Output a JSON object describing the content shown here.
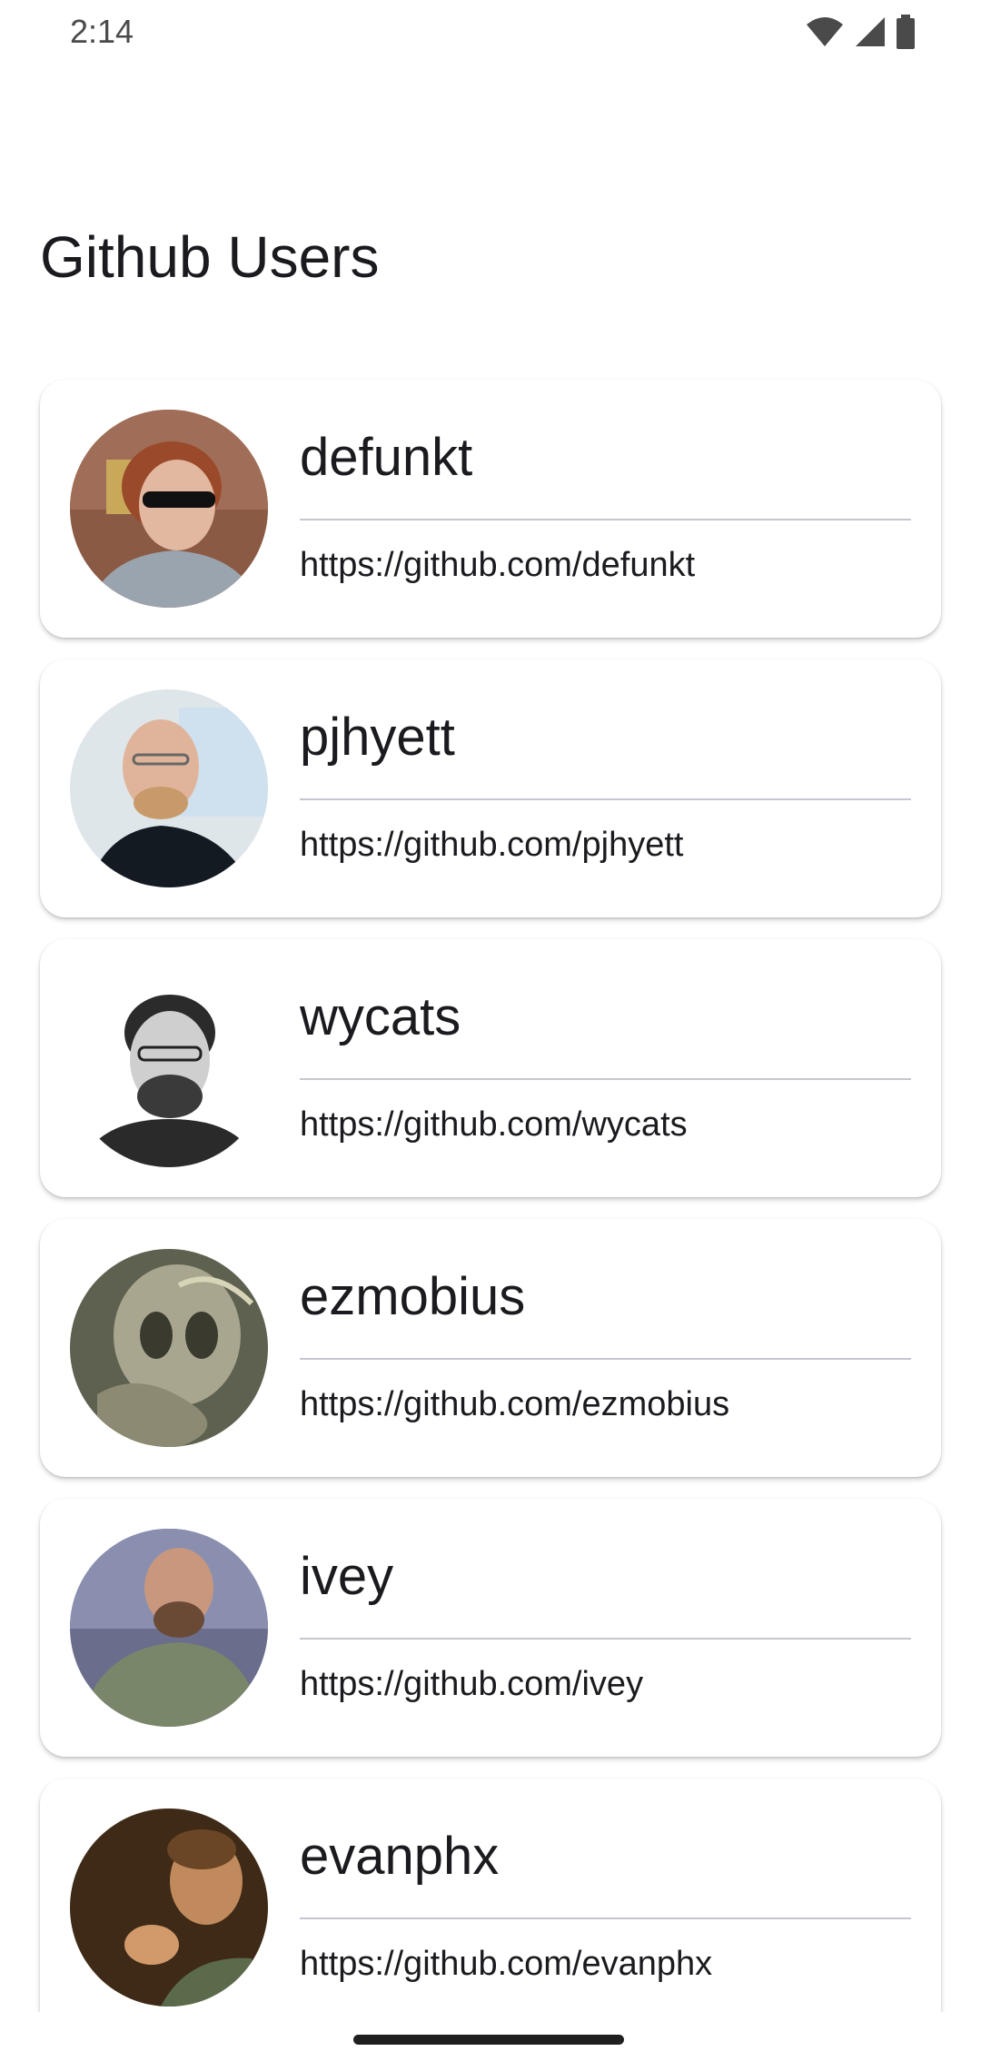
{
  "status_bar": {
    "time": "2:14",
    "icons": [
      "wifi-icon",
      "cell-signal-icon",
      "battery-icon"
    ]
  },
  "header": {
    "title": "Github Users"
  },
  "users": [
    {
      "login": "defunkt",
      "url": "https://github.com/defunkt"
    },
    {
      "login": "pjhyett",
      "url": "https://github.com/pjhyett"
    },
    {
      "login": "wycats",
      "url": "https://github.com/wycats"
    },
    {
      "login": "ezmobius",
      "url": "https://github.com/ezmobius"
    },
    {
      "login": "ivey",
      "url": "https://github.com/ivey"
    },
    {
      "login": "evanphx",
      "url": "https://github.com/evanphx"
    }
  ],
  "colors": {
    "background": "#ffffff",
    "text": "#1b1b1f",
    "divider": "#c8c4d0"
  }
}
